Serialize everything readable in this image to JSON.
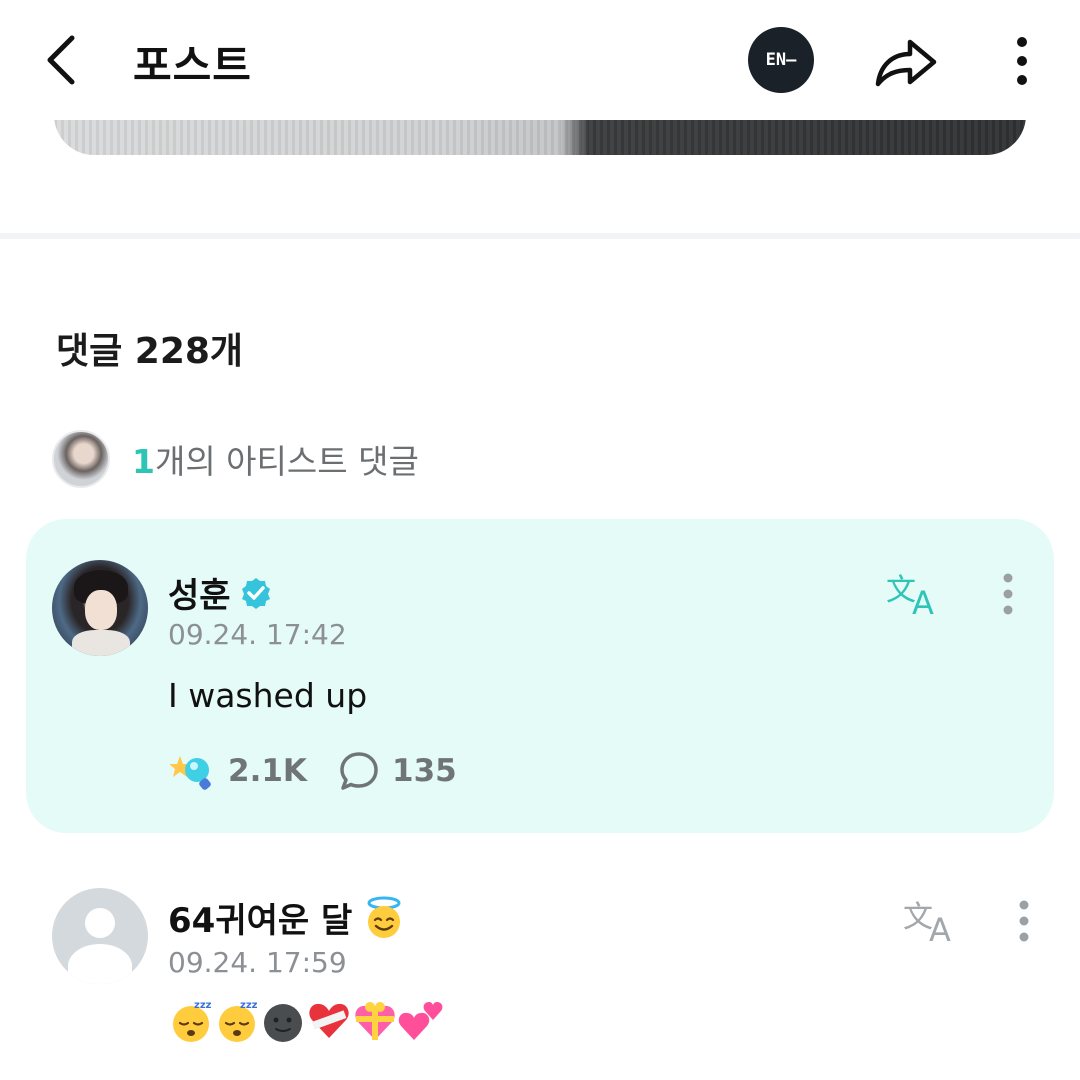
{
  "header": {
    "title": "포스트",
    "brand_logo": "EN–",
    "back_icon": "chevron-left-icon",
    "share_icon": "share-icon",
    "more_icon": "more-vertical-icon"
  },
  "comments": {
    "count_label": "댓글 228개"
  },
  "artist_summary": {
    "count": "1",
    "label": "개의 아티스트 댓글"
  },
  "artist_comment": {
    "author": "성훈",
    "timestamp": "09.24. 17:42",
    "text": "I washed up",
    "likes": "2.1K",
    "replies": "135",
    "translate_label": "文A"
  },
  "fan_comment": {
    "author": "64귀여운 달",
    "timestamp": "09.24. 17:59",
    "emojis": [
      "sleeping-face",
      "sleeping-face",
      "new-moon-face",
      "mending-heart",
      "gift-heart",
      "two-hearts"
    ],
    "translate_label": "文A"
  },
  "colors": {
    "accent": "#2ec4b6",
    "card_bg": "#e5fbf7",
    "muted": "#8c9094"
  }
}
